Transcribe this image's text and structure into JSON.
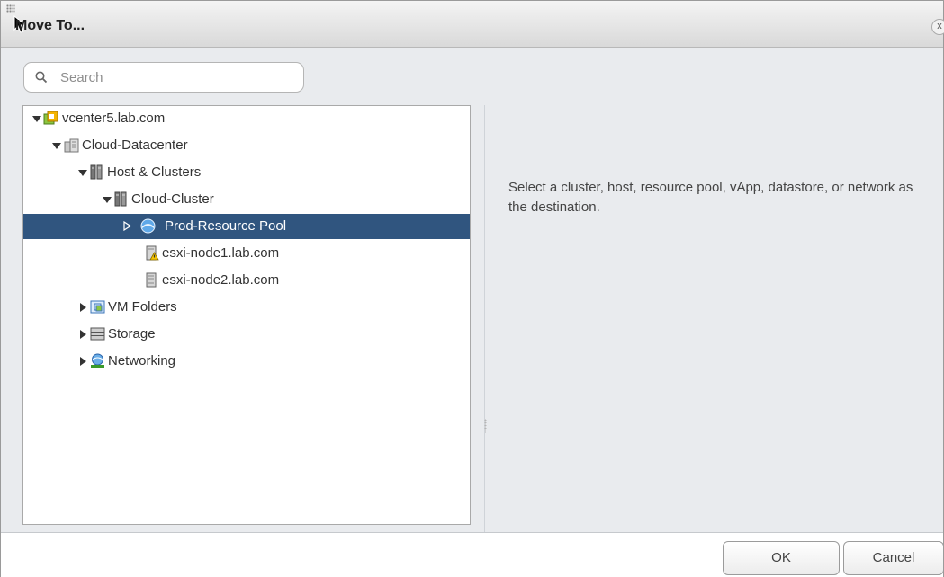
{
  "dialog": {
    "title": "Move To...",
    "close_glyph": "x"
  },
  "search": {
    "placeholder": "Search",
    "value": ""
  },
  "tree": {
    "nodes": [
      {
        "label": "vcenter5.lab.com",
        "icon": "vcenter-icon",
        "expander": "expanded"
      },
      {
        "label": "Cloud-Datacenter",
        "icon": "datacenter-icon",
        "expander": "expanded"
      },
      {
        "label": "Host & Clusters",
        "icon": "host-folder-icon",
        "expander": "expanded"
      },
      {
        "label": "Cloud-Cluster",
        "icon": "cluster-icon",
        "expander": "expanded"
      },
      {
        "label": "Prod-Resource Pool",
        "icon": "resource-pool-icon",
        "expander": "collapsed",
        "selected": true
      },
      {
        "label": "esxi-node1.lab.com",
        "icon": "host-warning-icon",
        "expander": "none"
      },
      {
        "label": "esxi-node2.lab.com",
        "icon": "host-icon",
        "expander": "none"
      },
      {
        "label": "VM Folders",
        "icon": "vm-folder-icon",
        "expander": "collapsed"
      },
      {
        "label": "Storage",
        "icon": "storage-icon",
        "expander": "collapsed"
      },
      {
        "label": "Networking",
        "icon": "network-icon",
        "expander": "collapsed"
      }
    ]
  },
  "info": {
    "text": "Select a cluster, host, resource pool, vApp, datastore, or network as the destination."
  },
  "buttons": {
    "ok": "OK",
    "cancel": "Cancel"
  },
  "colors": {
    "selection": "#30557f",
    "panel_bg": "#e9ebee",
    "tree_bg": "#ffffff"
  }
}
